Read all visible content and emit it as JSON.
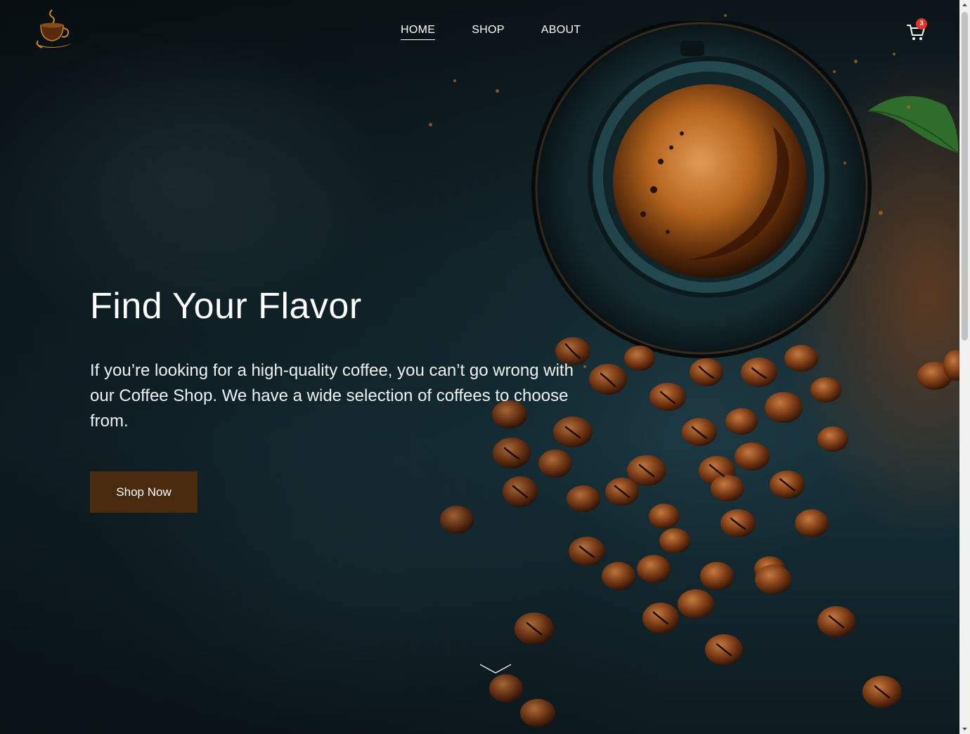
{
  "nav": {
    "items": [
      {
        "label": "HOME",
        "active": true
      },
      {
        "label": "SHOP",
        "active": false
      },
      {
        "label": "ABOUT",
        "active": false
      }
    ]
  },
  "cart": {
    "count": "3",
    "icon": "cart-icon"
  },
  "logo": {
    "icon": "coffee-cup-logo"
  },
  "hero": {
    "title": "Find Your Flavor",
    "text": "If you’re looking for a high-quality coffee, you can’t go wrong with our Coffee Shop. We have a wide selection of coffees to choose from.",
    "button_label": "Shop Now",
    "scroll_icon": "chevron-down-icon"
  },
  "colors": {
    "button_bg": "#4a2a0e",
    "badge": "#e5312b",
    "accent_logo": "#c8881e"
  }
}
